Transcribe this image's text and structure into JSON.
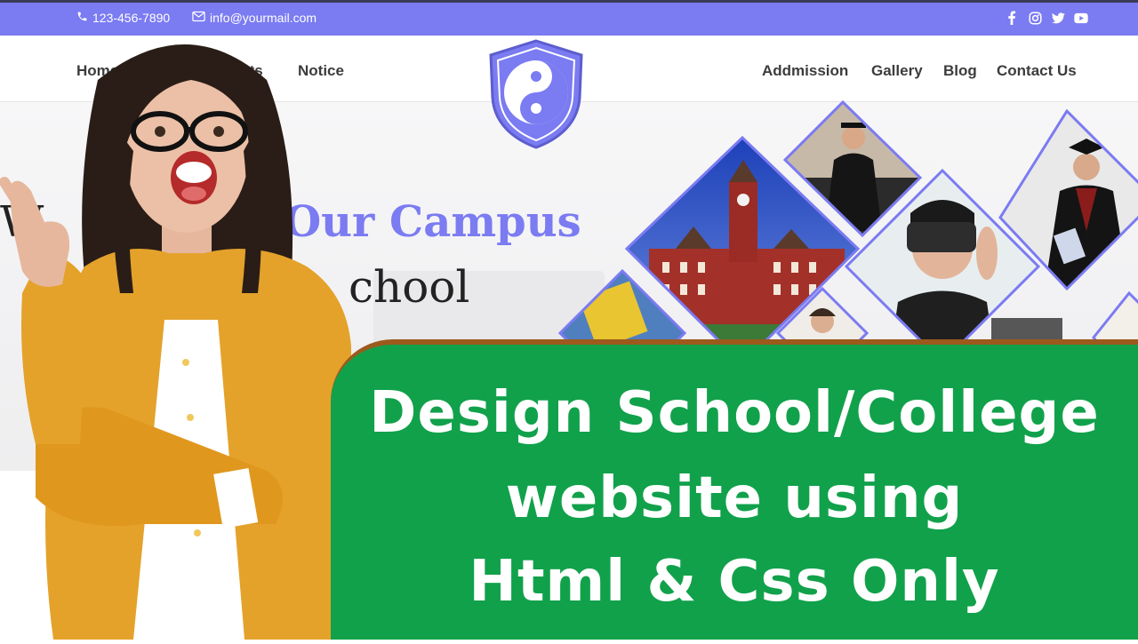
{
  "topbar": {
    "phone": "123-456-7890",
    "email": "info@yourmail.com",
    "phone_icon": "phone-icon",
    "email_icon": "envelope-icon",
    "social_icons": [
      "facebook-icon",
      "instagram-icon",
      "twitter-icon",
      "youtube-icon"
    ],
    "color": "#7b7bf2"
  },
  "nav": {
    "left": [
      "Home",
      "Events",
      "Notice"
    ],
    "right": [
      "Addmission",
      "Gallery",
      "Blog",
      "Contact Us"
    ],
    "logo_icon": "yin-yang-shield-icon"
  },
  "hero": {
    "title_part1": "W",
    "title_part2": "Our Campus",
    "subtitle_part": "chool"
  },
  "banner": {
    "line1": "Design School/College",
    "line2": "website using",
    "line3": "Html & Css Only",
    "color": "#11a14b"
  }
}
